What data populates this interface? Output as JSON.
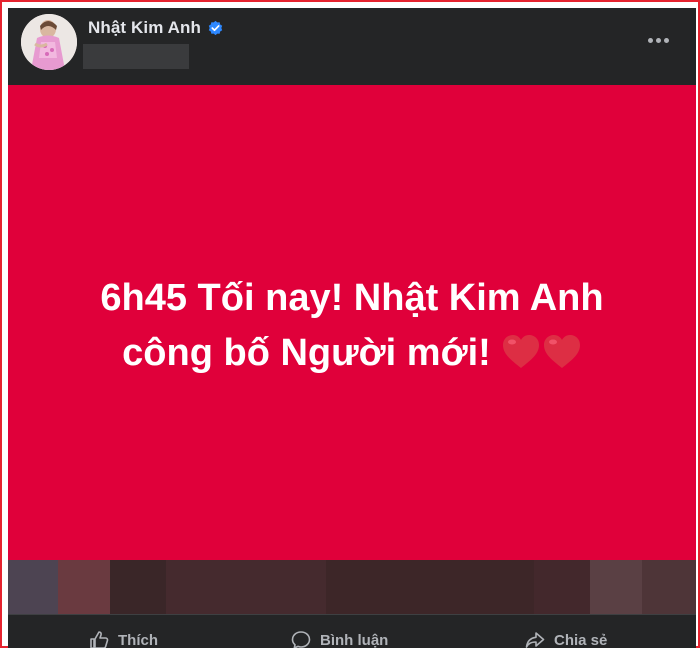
{
  "post": {
    "author": "Nhật Kim Anh",
    "verified_badge_icon": "verified-badge-icon",
    "more_icon": "more-options-icon",
    "body_background": "#e0003a",
    "text_line1": "6h45 Tối nay! Nhật Kim Anh",
    "text_line2": "công bố Người mới!",
    "emoji": "heart-icon"
  },
  "actions": [
    {
      "label": "Thích",
      "icon": "like-icon"
    },
    {
      "label": "Bình luận",
      "icon": "comment-icon"
    },
    {
      "label": "Chia sẻ",
      "icon": "share-icon"
    }
  ],
  "colors": {
    "frame_border": "#e5232f",
    "post_background": "#242526",
    "accent_blue": "#2d88ff",
    "text_primary": "#e4e6eb",
    "text_secondary": "#b0b3b8"
  }
}
